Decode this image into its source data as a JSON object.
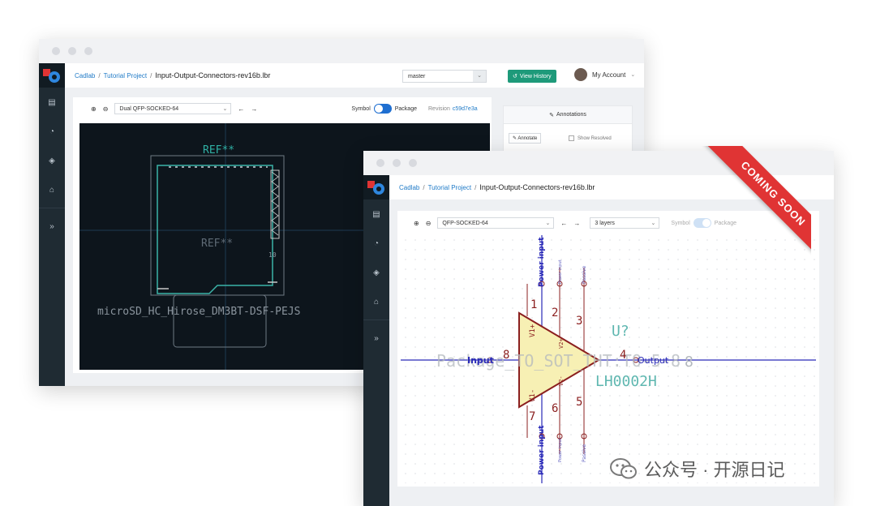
{
  "back_window": {
    "breadcrumb": {
      "org": "Cadlab",
      "project": "Tutorial Project",
      "separator": "/",
      "file": "Input-Output-Connectors-rev16b.lbr"
    },
    "branch": "master",
    "view_history": "View History",
    "account": "My Account",
    "toolbar": {
      "part_select": "Dual QFP-SOCKED-64",
      "symbol": "Symbol",
      "package": "Package",
      "revision_label": "Revision",
      "revision_id": "c59d7e3a"
    },
    "annotations": {
      "title": "Annotations",
      "annotate": "Annotate",
      "show_resolved": "Show Resolved"
    },
    "pcb": {
      "ref_top": "REF**",
      "ref_center": "REF**",
      "pin_num": "10",
      "footprint": "microSD_HC_Hirose_DM3BT-DSF-PEJS"
    }
  },
  "front_window": {
    "breadcrumb": {
      "org": "Cadlab",
      "project": "Tutorial Project",
      "separator": "/",
      "file": "Input-Output-Connectors-rev16b.lbr"
    },
    "toolbar": {
      "part_select": "QFP-SOCKED-64",
      "layers": "3 layers",
      "symbol": "Symbol",
      "package": "Package"
    },
    "schematic": {
      "power_input_top": "Power input",
      "power_input_bottom": "Power input",
      "power_input_small_top": "Power input",
      "power_input_small_bottom": "Power input",
      "passive_top": "Passive",
      "passive_bottom": "Passive",
      "input_label": "Input",
      "output_label": "Output",
      "ref": "U?",
      "value": "LH0002H",
      "package_text": "Package_TO_SOT_THT:TO-5-8",
      "v1_plus": "V1+",
      "v2_plus": "V2+",
      "v1_minus": "V1-",
      "v2_minus": "V2-",
      "pins": {
        "p1": "1",
        "p2": "2",
        "p3": "3",
        "p4": "4",
        "p5": "5",
        "p6": "6",
        "p7": "7",
        "p8": "8",
        "p8b": "8"
      }
    }
  },
  "ribbon": "COMING SOON",
  "watermark": {
    "text": "公众号 · 开源日记"
  },
  "colors": {
    "sidebar": "#1f2b33",
    "accent": "#1e9a7a",
    "link": "#1f7ac7",
    "ribbon": "#e03434",
    "pcb_bg": "#0d151c",
    "triangle_fill": "#f7f0b4",
    "triangle_stroke": "#8b1f1f",
    "net_blue": "#2a2ab8"
  }
}
